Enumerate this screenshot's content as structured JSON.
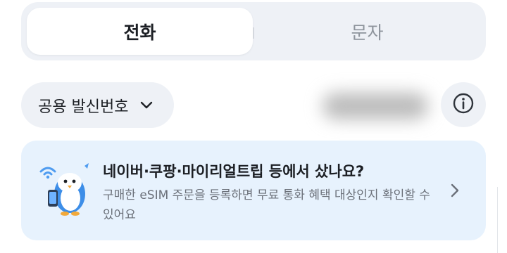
{
  "tabs": [
    {
      "label": "전화",
      "active": true
    },
    {
      "label": "문자",
      "active": false
    }
  ],
  "caller": {
    "label": "공용 발신번호",
    "dropdown_icon": "chevron-down-icon",
    "info_icon": "info-icon"
  },
  "banner": {
    "title": "네이버·쿠팡·마이리얼트립 등에서 샀나요?",
    "description": "구매한 eSIM 주문을 등록하면 무료 통화 혜택 대상인지 확인할 수 있어요",
    "illustration": "penguin-phone-illustration",
    "arrow_icon": "chevron-right-icon"
  },
  "colors": {
    "segment_bg": "#eef1f6",
    "banner_bg": "#e7f2fd",
    "text_primary": "#1c1f24",
    "text_secondary": "#6b7079",
    "accent_blue": "#3d8ee8"
  }
}
